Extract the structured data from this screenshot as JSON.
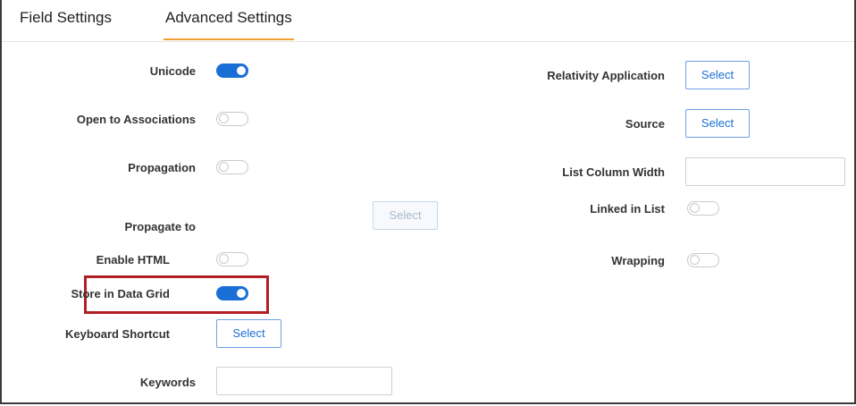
{
  "tabs": [
    {
      "label": "Field Settings",
      "active": false
    },
    {
      "label": "Advanced Settings",
      "active": true
    }
  ],
  "left_fields": {
    "unicode": {
      "label": "Unicode",
      "toggle": "on"
    },
    "open_to_associations": {
      "label": "Open to Associations",
      "toggle": "off"
    },
    "propagation": {
      "label": "Propagation",
      "toggle": "off"
    },
    "propagate_to": {
      "label": "Propagate to",
      "button": "Select"
    },
    "enable_html": {
      "label": "Enable HTML",
      "toggle": "off"
    },
    "store_in_data_grid": {
      "label": "Store in Data Grid",
      "toggle": "on"
    },
    "keyboard_shortcut": {
      "label": "Keyboard Shortcut",
      "button": "Select"
    },
    "keywords": {
      "label": "Keywords",
      "value": ""
    }
  },
  "right_fields": {
    "relativity_application": {
      "label": "Relativity Application",
      "button": "Select"
    },
    "source": {
      "label": "Source",
      "button": "Select"
    },
    "list_column_width": {
      "label": "List Column Width",
      "value": ""
    },
    "linked_in_list": {
      "label": "Linked in List",
      "toggle": "off"
    },
    "wrapping": {
      "label": "Wrapping",
      "toggle": "off"
    }
  },
  "colors": {
    "accent": "#1a6fd6",
    "tab_underline": "#f0a030",
    "highlight_box": "#b31f24"
  }
}
